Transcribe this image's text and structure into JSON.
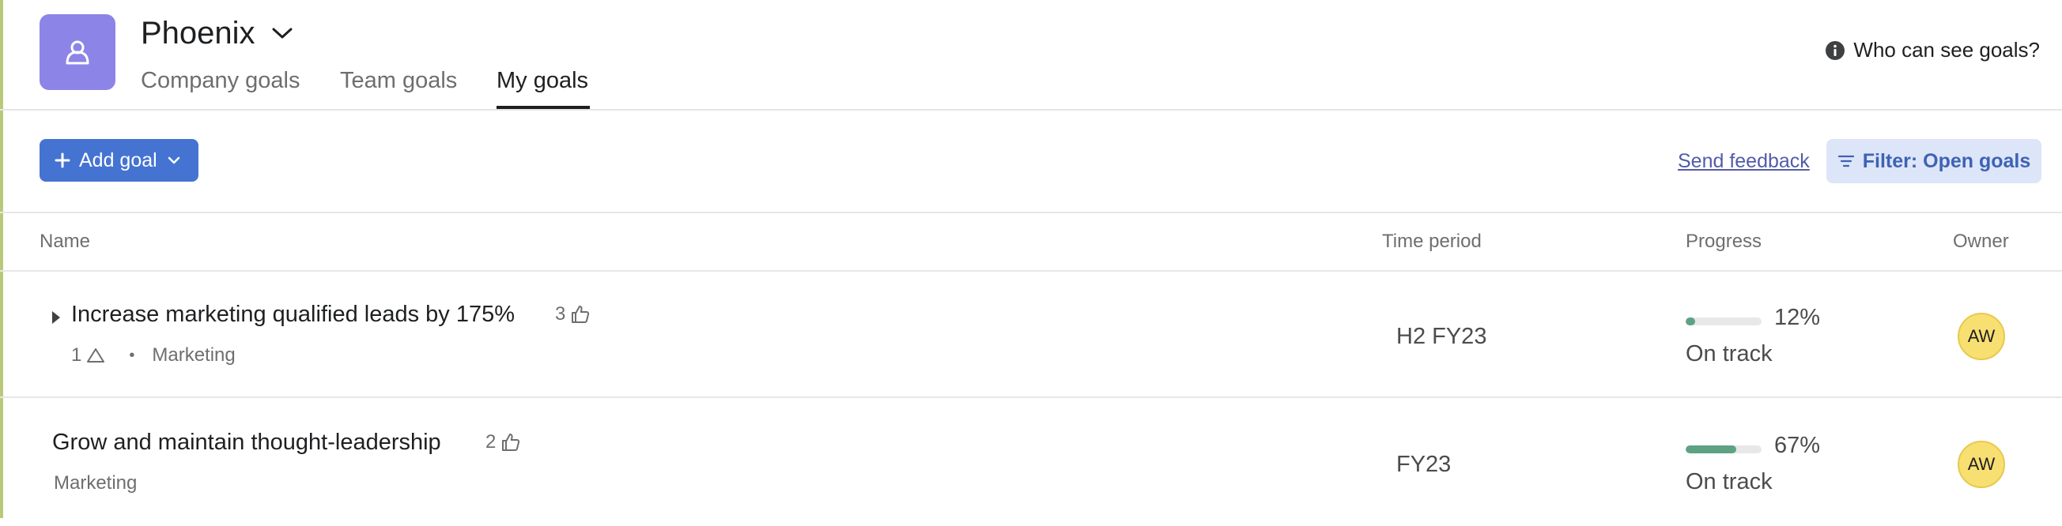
{
  "header": {
    "project_name": "Phoenix",
    "tabs": [
      {
        "label": "Company goals",
        "active": false
      },
      {
        "label": "Team goals",
        "active": false
      },
      {
        "label": "My goals",
        "active": true
      }
    ],
    "visibility_link": "Who can see goals?"
  },
  "toolbar": {
    "add_goal_label": "Add goal",
    "send_feedback_label": "Send feedback",
    "filter_label": "Filter: Open goals"
  },
  "table": {
    "columns": [
      "Name",
      "Time period",
      "Progress",
      "Owner"
    ],
    "rows": [
      {
        "name": "Increase marketing qualified leads by 175%",
        "likes": "3",
        "subgoal_count": "1",
        "team": "Marketing",
        "time_period": "H2 FY23",
        "progress": 0.12,
        "progress_label": "12%",
        "status": "On track",
        "owner_initials": "AW"
      },
      {
        "name": "Grow and maintain thought-leadership",
        "likes": "2",
        "team": "Marketing",
        "time_period": "FY23",
        "progress": 0.67,
        "progress_label": "67%",
        "status": "On track",
        "owner_initials": "AW"
      }
    ]
  },
  "colors": {
    "project_icon": "#8d84e8",
    "primary_button": "#4573d2",
    "filter_bg": "#dde5f8",
    "progress_green": "#5da283",
    "avatar_yellow": "#f8df72"
  },
  "icons": [
    "project-person-icon",
    "chevron-down-icon",
    "info-icon",
    "plus-icon",
    "filter-icon",
    "caret-right-icon",
    "thumbs-up-icon",
    "subgoal-triangle-icon"
  ]
}
